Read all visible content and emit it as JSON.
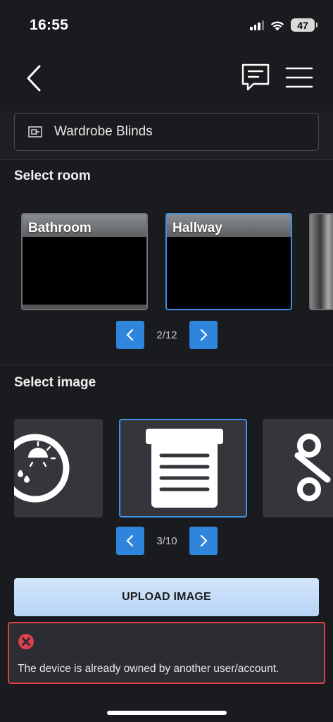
{
  "status_bar": {
    "time": "16:55",
    "battery": "47"
  },
  "device": {
    "name": "Wardrobe Blinds"
  },
  "room_section": {
    "title": "Select room",
    "cards": [
      {
        "label": "Bathroom",
        "selected": false
      },
      {
        "label": "Hallway",
        "selected": true
      },
      {
        "label": "",
        "selected": false
      }
    ],
    "pager": "2/12"
  },
  "image_section": {
    "title": "Select image",
    "cards": [
      {
        "icon": "weather-icon",
        "selected": false
      },
      {
        "icon": "blinds-icon",
        "selected": true
      },
      {
        "icon": "node-icon",
        "selected": false
      }
    ],
    "pager": "3/10"
  },
  "upload": {
    "label": "UPLOAD IMAGE"
  },
  "error_toast": {
    "message": "The device is already owned by another user/account."
  },
  "colors": {
    "accent": "#2f84dc",
    "selected_border": "#3f8fe6",
    "error": "#e0404c"
  }
}
